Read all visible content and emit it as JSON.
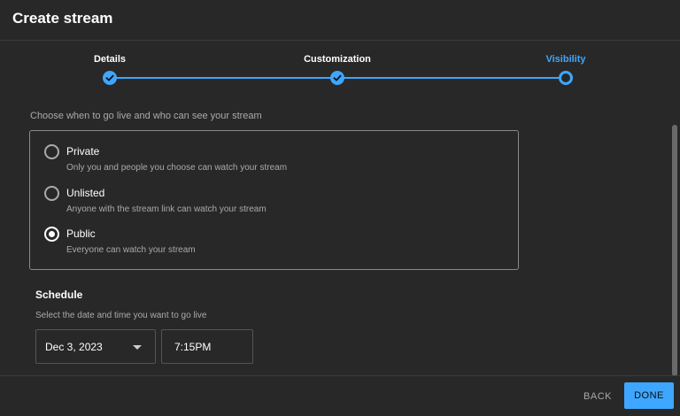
{
  "dialog": {
    "title": "Create stream"
  },
  "stepper": {
    "steps": [
      {
        "label": "Details",
        "state": "done"
      },
      {
        "label": "Customization",
        "state": "done"
      },
      {
        "label": "Visibility",
        "state": "current"
      }
    ],
    "accent": "#3ea6ff"
  },
  "visibility": {
    "subtitle": "Choose when to go live and who can see your stream",
    "options": [
      {
        "label": "Private",
        "description": "Only you and people you choose can watch your stream",
        "selected": false
      },
      {
        "label": "Unlisted",
        "description": "Anyone with the stream link can watch your stream",
        "selected": false
      },
      {
        "label": "Public",
        "description": "Everyone can watch your stream",
        "selected": true
      }
    ]
  },
  "schedule": {
    "title": "Schedule",
    "subtitle": "Select the date and time you want to go live",
    "date": "Dec 3, 2023",
    "time": "7:15PM"
  },
  "footer": {
    "back_label": "BACK",
    "done_label": "DONE"
  }
}
